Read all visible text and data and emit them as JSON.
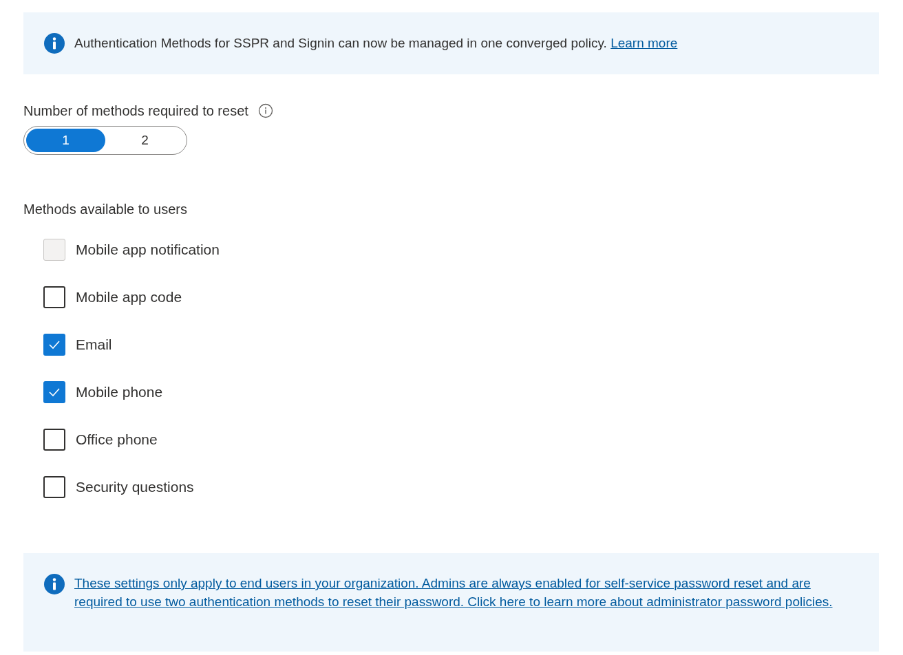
{
  "top_notice": {
    "text": "Authentication Methods for SSPR and Signin can now be managed in one converged policy.",
    "link": "Learn more"
  },
  "methods_required": {
    "label": "Number of methods required to reset",
    "options": [
      {
        "label": "1",
        "selected": true
      },
      {
        "label": "2",
        "selected": false
      }
    ]
  },
  "methods_available": {
    "label": "Methods available to users",
    "items": [
      {
        "label": "Mobile app notification",
        "checked": false,
        "disabled": true
      },
      {
        "label": "Mobile app code",
        "checked": false,
        "disabled": false
      },
      {
        "label": "Email",
        "checked": true,
        "disabled": false
      },
      {
        "label": "Mobile phone",
        "checked": true,
        "disabled": false
      },
      {
        "label": "Office phone",
        "checked": false,
        "disabled": false
      },
      {
        "label": "Security questions",
        "checked": false,
        "disabled": false
      }
    ]
  },
  "bottom_notice": {
    "link": "These settings only apply to end users in your organization. Admins are always enabled for self-service password reset and are required to use two authentication methods to reset their password. Click here to learn more about administrator password policies."
  }
}
